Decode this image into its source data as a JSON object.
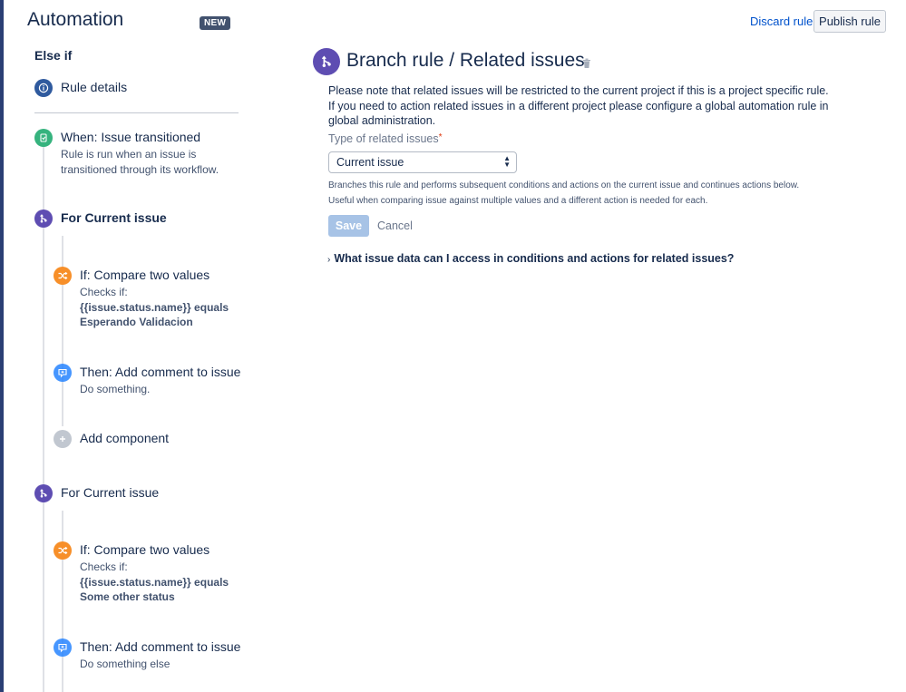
{
  "header": {
    "title": "Automation",
    "badge": "NEW",
    "discard_label": "Discard rule",
    "publish_label": "Publish rule"
  },
  "sidebar": {
    "section_title": "Else if",
    "rule_details": "Rule details",
    "trigger": {
      "title": "When: Issue transitioned",
      "desc_line1": "Rule is run when an issue is",
      "desc_line2": "transitioned through its workflow."
    },
    "branch1": {
      "title": "For Current issue",
      "condition": {
        "title": "If: Compare two values",
        "checks": "Checks if:",
        "expr": "{{issue.status.name}} equals",
        "value": "Esperando Validacion"
      },
      "action": {
        "title": "Then: Add comment to issue",
        "desc": "Do something."
      },
      "add_component": "Add component"
    },
    "branch2": {
      "title": "For Current issue",
      "condition": {
        "title": "If: Compare two values",
        "checks": "Checks if:",
        "expr": "{{issue.status.name}} equals",
        "value": "Some other status"
      },
      "action": {
        "title": "Then: Add comment to issue",
        "desc": "Do something else"
      }
    }
  },
  "main": {
    "title": "Branch rule / Related issues",
    "note": "Please note that related issues will be restricted to the current project if this is a project specific rule. If you need to action related issues in a different project please configure a global automation rule in global administration.",
    "field_label": "Type of related issues",
    "required_mark": "*",
    "select_value": "Current issue",
    "help_line1": "Branches this rule and performs subsequent conditions and actions on the current issue and continues actions below.",
    "help_line2": "Useful when comparing issue against multiple values and a different action is needed for each.",
    "save_label": "Save",
    "cancel_label": "Cancel",
    "expand_label": "What issue data can I access in conditions and actions for related issues?"
  },
  "colors": {
    "branch": "#5e4db2",
    "condition": "#f78f29",
    "trigger": "#36b37e",
    "action": "#2684ff",
    "link": "#0052cc"
  }
}
